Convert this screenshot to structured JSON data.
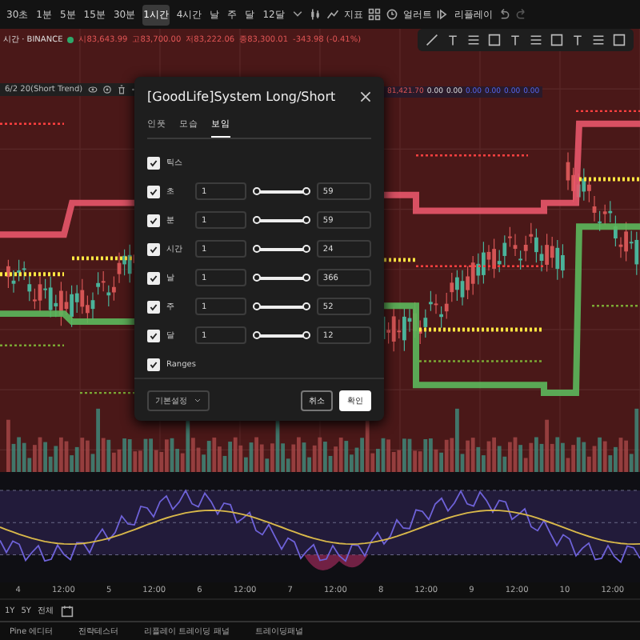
{
  "toolbar": {
    "timeframes": [
      {
        "label": "30초",
        "selected": false
      },
      {
        "label": "1분",
        "selected": false
      },
      {
        "label": "5분",
        "selected": false
      },
      {
        "label": "15분",
        "selected": false
      },
      {
        "label": "30분",
        "selected": false
      },
      {
        "label": "1시간",
        "selected": true
      },
      {
        "label": "4시간",
        "selected": false
      },
      {
        "label": "날",
        "selected": false
      },
      {
        "label": "주",
        "selected": false
      },
      {
        "label": "달",
        "selected": false
      },
      {
        "label": "12달",
        "selected": false
      }
    ],
    "indicators": "지표",
    "alert": "얼러트",
    "replay": "리플레이"
  },
  "symbol_bar": {
    "symbol": "시간 · BINANCE",
    "ohlc": [
      "시83,643.99",
      "고83,700.00",
      "저83,222.06",
      "종83,300.01"
    ],
    "change": "-343.98 (-0.41%)"
  },
  "indicator_label": "6/2 20(Short Trend)",
  "indicator_values": [
    "81,421.70",
    "0.00",
    "0.00",
    "0.00",
    "0.00",
    "0.00",
    "0.00"
  ],
  "dialog": {
    "title": "[GoodLife]System Long/Short",
    "tabs": [
      {
        "label": "인풋",
        "selected": false
      },
      {
        "label": "모습",
        "selected": false
      },
      {
        "label": "보임",
        "selected": true
      }
    ],
    "rows": [
      {
        "kind": "check",
        "label": "틱스",
        "checked": true
      },
      {
        "kind": "range",
        "label": "초",
        "checked": true,
        "from": "1",
        "to": "59",
        "level": 1
      },
      {
        "kind": "range",
        "label": "분",
        "checked": true,
        "from": "1",
        "to": "59",
        "level": 1
      },
      {
        "kind": "range",
        "label": "시간",
        "checked": true,
        "from": "1",
        "to": "24",
        "level": 1
      },
      {
        "kind": "range",
        "label": "날",
        "checked": true,
        "from": "1",
        "to": "366",
        "level": 1
      },
      {
        "kind": "range",
        "label": "주",
        "checked": true,
        "from": "1",
        "to": "52",
        "level": 1
      },
      {
        "kind": "range",
        "label": "달",
        "checked": true,
        "from": "1",
        "to": "12",
        "level": 1
      },
      {
        "kind": "check",
        "label": "Ranges",
        "checked": true
      }
    ],
    "defaults": "기본설정",
    "cancel": "취소",
    "ok": "확인"
  },
  "time_axis": [
    "4",
    "12:00",
    "5",
    "12:00",
    "6",
    "12:00",
    "7",
    "12:00",
    "8",
    "12:00",
    "9",
    "12:00",
    "10",
    "12:00"
  ],
  "ranges": [
    "1Y",
    "5Y",
    "전체"
  ],
  "bottom_tabs": [
    "Pine 에디터",
    "전략테스터",
    "리플레이 트레이딩 패널",
    "트레이딩패널"
  ]
}
